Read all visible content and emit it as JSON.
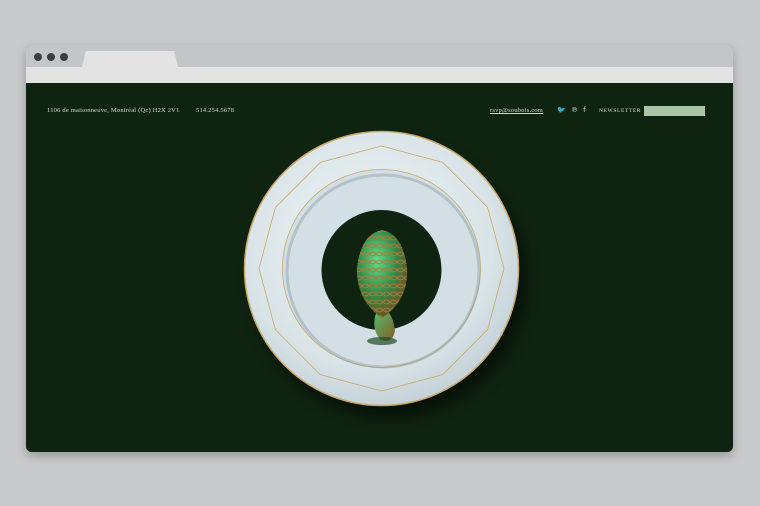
{
  "browser": {
    "tab_label": "",
    "window_controls": [
      "close-dot",
      "minimize-dot",
      "maximize-dot"
    ]
  },
  "site": {
    "address": "1106 de maisonneuve, Montréal (Qc) H2X 2V1",
    "phone": "514.254.5678",
    "email": "rsvp@soubois.com",
    "social": [
      {
        "name": "twitter-icon",
        "glyph": "🐦"
      },
      {
        "name": "pinterest-icon",
        "glyph": "℗"
      },
      {
        "name": "facebook-icon",
        "glyph": "f"
      }
    ],
    "newsletter_label": "NEWSLETTER",
    "newsletter_value": ""
  },
  "colors": {
    "background": "#0f2410",
    "plate": "#d9e4e8",
    "gold_rim": "#c9a766",
    "newsletter_field": "#a9c5a6"
  },
  "hero": {
    "image": "morel-mushroom-on-plate"
  }
}
